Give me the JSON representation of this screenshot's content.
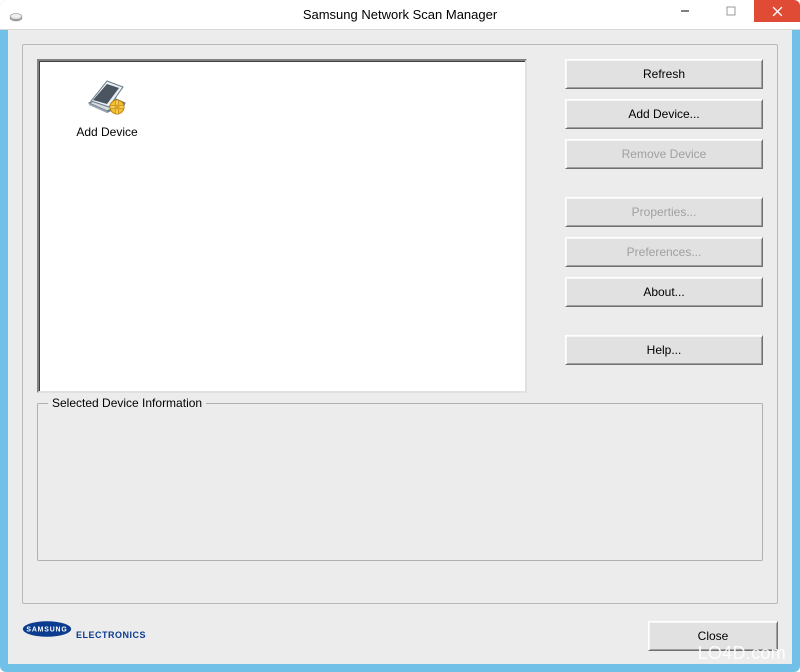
{
  "window": {
    "title": "Samsung Network Scan Manager"
  },
  "deviceList": {
    "items": [
      {
        "label": "Add Device"
      }
    ]
  },
  "buttons": {
    "refresh": "Refresh",
    "addDevice": "Add Device...",
    "removeDevice": "Remove Device",
    "properties": "Properties...",
    "preferences": "Preferences...",
    "about": "About...",
    "help": "Help..."
  },
  "fieldset": {
    "legend": "Selected Device Information"
  },
  "footer": {
    "brandText": "ELECTRONICS",
    "closeLabel": "Close"
  },
  "watermark": "LO4D.com"
}
